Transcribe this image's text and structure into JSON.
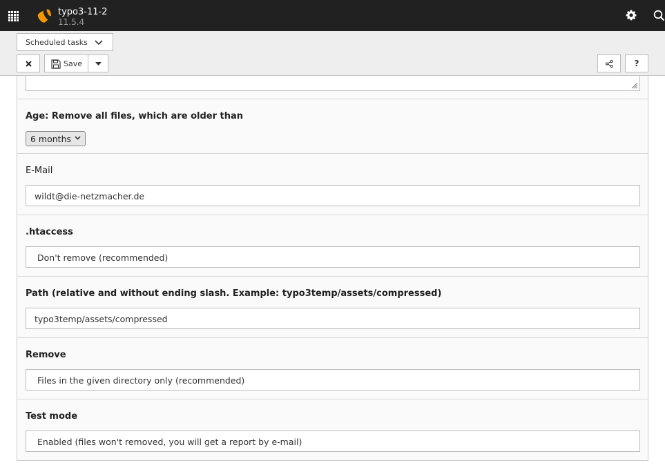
{
  "topbar": {
    "site_name": "typo3-11-2",
    "site_version": "11.5.4",
    "icons": [
      "apps-icon",
      "typo3-logo",
      "gear-icon",
      "search-icon"
    ]
  },
  "docheader": {
    "menu_select_value": "Scheduled tasks",
    "save_label": "Save",
    "help_label": "?"
  },
  "form": {
    "age": {
      "label": "Age: Remove all files, which are older than",
      "value": "6 months"
    },
    "email": {
      "label": "E-Mail",
      "value": "wildt@die-netzmacher.de"
    },
    "htaccess": {
      "label": ".htaccess",
      "value": "Don't remove (recommended)"
    },
    "path": {
      "label": "Path (relative and without ending slash. Example: typo3temp/assets/compressed)",
      "value": "typo3temp/assets/compressed"
    },
    "remove": {
      "label": "Remove",
      "value": "Files in the given directory only (recommended)"
    },
    "testmode": {
      "label": "Test mode",
      "value": "Enabled (files won't removed, you will get a report by e-mail)"
    }
  },
  "colors": {
    "topbar": "#212121",
    "logo": "#f49700",
    "docheader": "#eeeeee"
  }
}
